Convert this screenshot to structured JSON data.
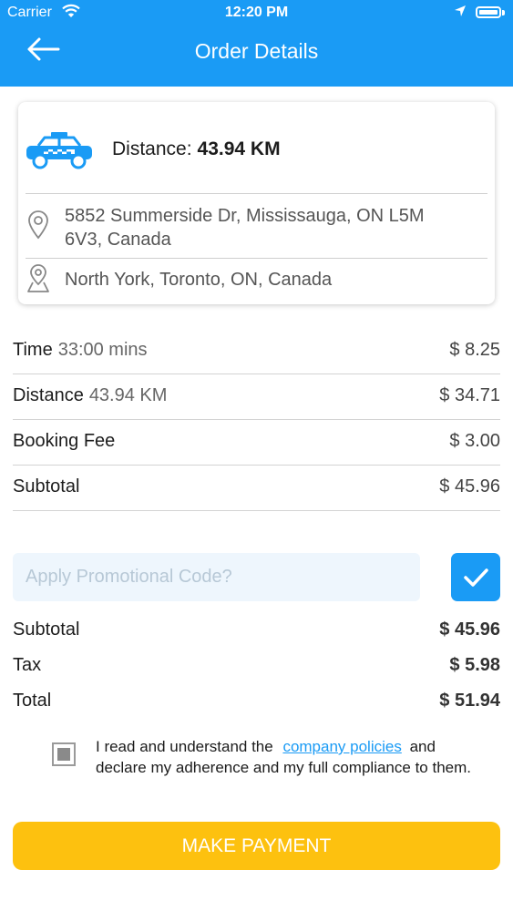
{
  "status_bar": {
    "carrier": "Carrier",
    "time": "12:20 PM"
  },
  "header": {
    "title": "Order Details"
  },
  "trip": {
    "distance_label": "Distance:",
    "distance_value": "43.94 KM",
    "pickup": "5852 Summerside Dr, Mississauga, ON L5M 6V3, Canada",
    "dropoff": "North York, Toronto, ON, Canada"
  },
  "fare": [
    {
      "label": "Time",
      "detail": "33:00 mins",
      "amount": "$ 8.25"
    },
    {
      "label": "Distance",
      "detail": "43.94 KM",
      "amount": "$ 34.71"
    },
    {
      "label": "Booking Fee",
      "detail": "",
      "amount": "$ 3.00"
    },
    {
      "label": "Subtotal",
      "detail": "",
      "amount": "$ 45.96"
    }
  ],
  "promo": {
    "placeholder": "Apply Promotional Code?",
    "value": ""
  },
  "summary": [
    {
      "label": "Subtotal",
      "amount": "$ 45.96"
    },
    {
      "label": "Tax",
      "amount": "$ 5.98"
    },
    {
      "label": "Total",
      "amount": "$ 51.94"
    }
  ],
  "agreement": {
    "text_before": "I read and understand the",
    "link": "company policies",
    "text_after": "and declare my adherence and my full compliance to them."
  },
  "payment_button": {
    "label": "MAKE PAYMENT"
  },
  "colors": {
    "primary": "#1a9bf5",
    "button": "#fdc10f",
    "promo_bg": "#eef6fd"
  }
}
